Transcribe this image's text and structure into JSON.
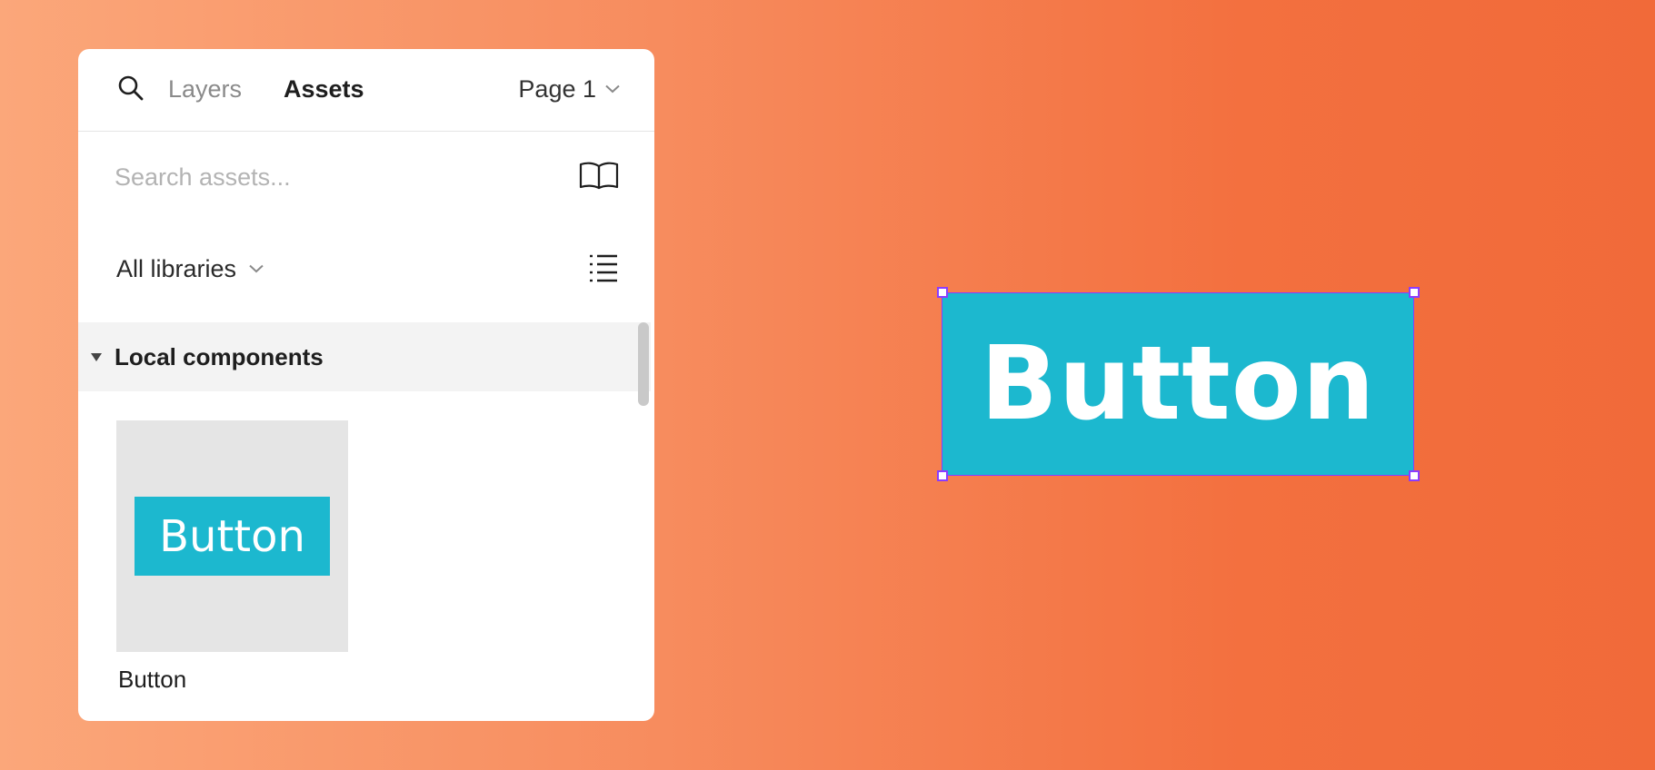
{
  "panel": {
    "tabs": {
      "layers": "Layers",
      "assets": "Assets"
    },
    "page_select": "Page 1",
    "search": {
      "placeholder": "Search assets...",
      "value": ""
    },
    "library_select": "All libraries",
    "section": {
      "title": "Local components",
      "expanded": true
    },
    "assets": [
      {
        "name": "Button",
        "preview_text": "Button"
      }
    ]
  },
  "canvas": {
    "component_text": "Button",
    "selected": true
  },
  "colors": {
    "component_fill": "#1cb8cf",
    "selection": "#8a3cff",
    "thumb_bg": "#e5e5e5",
    "background_start": "#fba77a",
    "background_end": "#f16a39"
  },
  "icons": {
    "search": "search-icon",
    "library": "book-icon",
    "view": "list-view-icon",
    "page_dropdown": "chevron-down-icon",
    "section_toggle": "caret-down-icon"
  }
}
